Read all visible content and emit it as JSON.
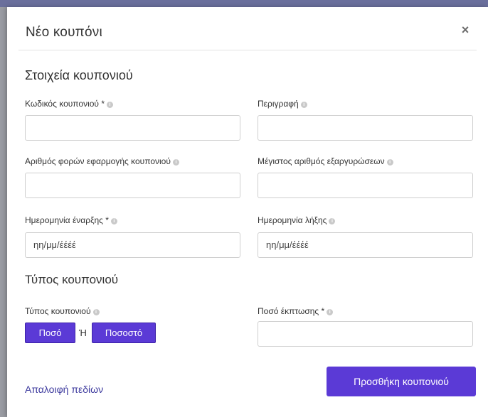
{
  "modal": {
    "title": "Νέο κουπόνι",
    "close_symbol": "×"
  },
  "section_details": {
    "title": "Στοιχεία κουπονιού"
  },
  "fields": {
    "coupon_code": {
      "label": "Κωδικός κουπονιού *",
      "value": ""
    },
    "description": {
      "label": "Περιγραφή",
      "value": ""
    },
    "uses_count": {
      "label": "Αριθμός φορών εφαρμογής κουπονιού",
      "value": ""
    },
    "max_redemptions": {
      "label": "Μέγιστος αριθμός εξαργυρώσεων",
      "value": ""
    },
    "start_date": {
      "label": "Ημερομηνία έναρξης *",
      "placeholder": "ηη/μμ/έέέέ"
    },
    "end_date": {
      "label": "Ημερομηνία λήξης",
      "placeholder": "ηη/μμ/έέέέ"
    },
    "discount_amount": {
      "label": "Ποσό έκπτωσης *",
      "value": ""
    }
  },
  "section_type": {
    "title": "Τύπος κουπονιού",
    "field_label": "Τύπος κουπονιού",
    "amount_button": "Ποσό",
    "or_text": "Ή",
    "percent_button": "Ποσοστό"
  },
  "footer": {
    "clear_link": "Απαλοιφή πεδίων",
    "submit_button": "Προσθήκη κουπονιού"
  },
  "info_icon_symbol": "i",
  "colors": {
    "accent": "#5b3ad6",
    "link": "#3d3a9e"
  }
}
